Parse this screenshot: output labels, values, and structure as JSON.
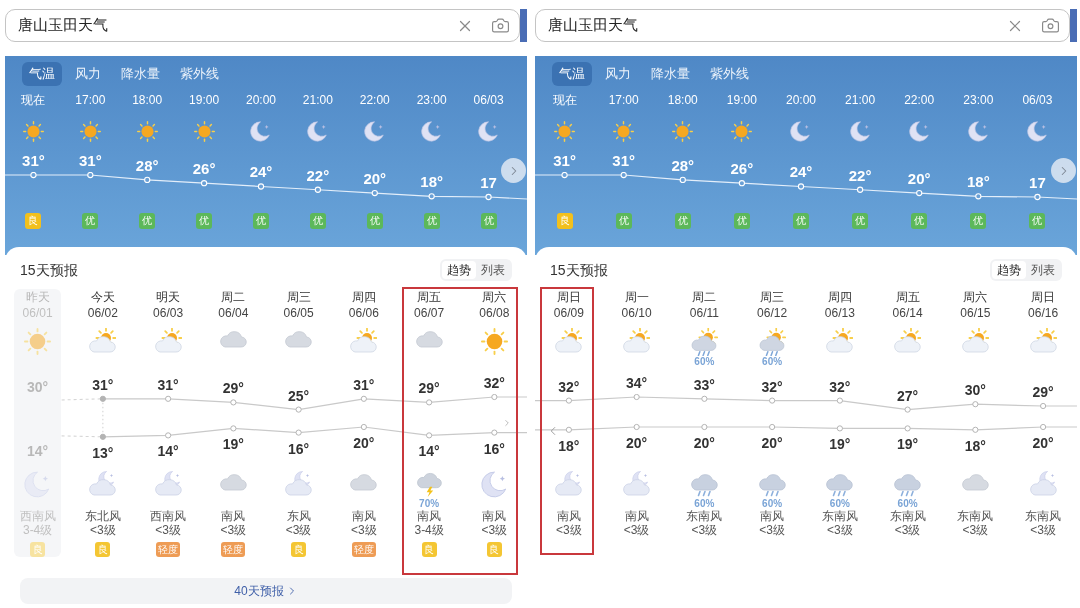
{
  "panels": [
    {
      "search": {
        "value": "唐山玉田天气"
      },
      "hourly": {
        "tabs": [
          {
            "label": "气温",
            "selected": true
          },
          {
            "label": "风力",
            "selected": false
          },
          {
            "label": "降水量",
            "selected": false
          },
          {
            "label": "紫外线",
            "selected": false
          }
        ],
        "has_next": true,
        "hours": [
          {
            "time": "现在",
            "weather": {
              "kind": "sun"
            },
            "temp": "31°",
            "aqi": {
              "label": "良",
              "color": "#f2c01c"
            }
          },
          {
            "time": "17:00",
            "weather": {
              "kind": "sun"
            },
            "temp": "31°",
            "aqi": {
              "label": "优",
              "color": "#5cb85a"
            }
          },
          {
            "time": "18:00",
            "weather": {
              "kind": "sun"
            },
            "temp": "28°",
            "aqi": {
              "label": "优",
              "color": "#5cb85a"
            }
          },
          {
            "time": "19:00",
            "weather": {
              "kind": "sun"
            },
            "temp": "26°",
            "aqi": {
              "label": "优",
              "color": "#5cb85a"
            }
          },
          {
            "time": "20:00",
            "weather": {
              "kind": "moon"
            },
            "temp": "24°",
            "aqi": {
              "label": "优",
              "color": "#5cb85a"
            }
          },
          {
            "time": "21:00",
            "weather": {
              "kind": "moon"
            },
            "temp": "22°",
            "aqi": {
              "label": "优",
              "color": "#5cb85a"
            }
          },
          {
            "time": "22:00",
            "weather": {
              "kind": "moon"
            },
            "temp": "20°",
            "aqi": {
              "label": "优",
              "color": "#5cb85a"
            }
          },
          {
            "time": "23:00",
            "weather": {
              "kind": "moon"
            },
            "temp": "18°",
            "aqi": {
              "label": "优",
              "color": "#5cb85a"
            }
          },
          {
            "time": "06/03",
            "weather": {
              "kind": "moon"
            },
            "temp": "17",
            "aqi": {
              "label": "优",
              "color": "#5cb85a"
            }
          }
        ]
      },
      "forecast": {
        "title": "15天预报",
        "views": [
          {
            "label": "趋势",
            "selected": true
          },
          {
            "label": "列表",
            "selected": false
          }
        ],
        "has_next": true,
        "days": [
          {
            "day": "昨天",
            "date": "06/01",
            "past": true,
            "highlighted": false,
            "day_weather": {
              "kind": "sun"
            },
            "high": "30°",
            "low": "14°",
            "night_weather": {
              "kind": "moon"
            },
            "wind": "西南风",
            "wind_level": "3-4级",
            "aqi": {
              "label": "良",
              "color": "#f7e3a0"
            }
          },
          {
            "day": "今天",
            "date": "06/02",
            "past": false,
            "highlighted": false,
            "day_weather": {
              "kind": "suncloud"
            },
            "high": "31°",
            "low": "13°",
            "night_weather": {
              "kind": "mooncloud"
            },
            "wind": "东北风",
            "wind_level": "<3级",
            "aqi": {
              "label": "良",
              "color": "#f4c633"
            }
          },
          {
            "day": "明天",
            "date": "06/03",
            "past": false,
            "highlighted": false,
            "day_weather": {
              "kind": "suncloud"
            },
            "high": "31°",
            "low": "14°",
            "night_weather": {
              "kind": "mooncloud"
            },
            "wind": "西南风",
            "wind_level": "<3级",
            "aqi": {
              "label": "轻度",
              "color": "#ee9c55"
            }
          },
          {
            "day": "周二",
            "date": "06/04",
            "past": false,
            "highlighted": false,
            "day_weather": {
              "kind": "cloud"
            },
            "high": "29°",
            "low": "19°",
            "night_weather": {
              "kind": "cloud"
            },
            "wind": "南风",
            "wind_level": "<3级",
            "aqi": {
              "label": "轻度",
              "color": "#ee9c55"
            }
          },
          {
            "day": "周三",
            "date": "06/05",
            "past": false,
            "highlighted": false,
            "day_weather": {
              "kind": "cloud"
            },
            "high": "25°",
            "low": "16°",
            "night_weather": {
              "kind": "mooncloud"
            },
            "wind": "东风",
            "wind_level": "<3级",
            "aqi": {
              "label": "良",
              "color": "#f4c633"
            }
          },
          {
            "day": "周四",
            "date": "06/06",
            "past": false,
            "highlighted": false,
            "day_weather": {
              "kind": "suncloud"
            },
            "high": "31°",
            "low": "20°",
            "night_weather": {
              "kind": "cloud"
            },
            "wind": "南风",
            "wind_level": "<3级",
            "aqi": {
              "label": "轻度",
              "color": "#ee9c55"
            }
          },
          {
            "day": "周五",
            "date": "06/07",
            "past": false,
            "highlighted": true,
            "day_weather": {
              "kind": "cloud"
            },
            "high": "29°",
            "low": "14°",
            "night_weather": {
              "kind": "storm",
              "precip": "70%"
            },
            "wind": "南风",
            "wind_level": "3-4级",
            "aqi": {
              "label": "良",
              "color": "#f4c633"
            }
          },
          {
            "day": "周六",
            "date": "06/08",
            "past": false,
            "highlighted": true,
            "day_weather": {
              "kind": "sun"
            },
            "high": "32°",
            "low": "16°",
            "night_weather": {
              "kind": "moon"
            },
            "wind": "南风",
            "wind_level": "<3级",
            "aqi": {
              "label": "良",
              "color": "#f4c633"
            }
          }
        ],
        "more_button": "40天预报"
      }
    },
    {
      "search": {
        "value": "唐山玉田天气"
      },
      "hourly": {
        "tabs": [
          {
            "label": "气温",
            "selected": true
          },
          {
            "label": "风力",
            "selected": false
          },
          {
            "label": "降水量",
            "selected": false
          },
          {
            "label": "紫外线",
            "selected": false
          }
        ],
        "has_next": true,
        "hours": [
          {
            "time": "现在",
            "weather": {
              "kind": "sun"
            },
            "temp": "31°",
            "aqi": {
              "label": "良",
              "color": "#f2c01c"
            }
          },
          {
            "time": "17:00",
            "weather": {
              "kind": "sun"
            },
            "temp": "31°",
            "aqi": {
              "label": "优",
              "color": "#5cb85a"
            }
          },
          {
            "time": "18:00",
            "weather": {
              "kind": "sun"
            },
            "temp": "28°",
            "aqi": {
              "label": "优",
              "color": "#5cb85a"
            }
          },
          {
            "time": "19:00",
            "weather": {
              "kind": "sun"
            },
            "temp": "26°",
            "aqi": {
              "label": "优",
              "color": "#5cb85a"
            }
          },
          {
            "time": "20:00",
            "weather": {
              "kind": "moon"
            },
            "temp": "24°",
            "aqi": {
              "label": "优",
              "color": "#5cb85a"
            }
          },
          {
            "time": "21:00",
            "weather": {
              "kind": "moon"
            },
            "temp": "22°",
            "aqi": {
              "label": "优",
              "color": "#5cb85a"
            }
          },
          {
            "time": "22:00",
            "weather": {
              "kind": "moon"
            },
            "temp": "20°",
            "aqi": {
              "label": "优",
              "color": "#5cb85a"
            }
          },
          {
            "time": "23:00",
            "weather": {
              "kind": "moon"
            },
            "temp": "18°",
            "aqi": {
              "label": "优",
              "color": "#5cb85a"
            }
          },
          {
            "time": "06/03",
            "weather": {
              "kind": "moon"
            },
            "temp": "17",
            "aqi": {
              "label": "优",
              "color": "#5cb85a"
            }
          }
        ]
      },
      "forecast": {
        "title": "15天预报",
        "views": [
          {
            "label": "趋势",
            "selected": true
          },
          {
            "label": "列表",
            "selected": false
          }
        ],
        "has_prev": true,
        "days": [
          {
            "day": "周日",
            "date": "06/09",
            "past": false,
            "highlighted": true,
            "day_weather": {
              "kind": "suncloud"
            },
            "high": "32°",
            "low": "18°",
            "night_weather": {
              "kind": "mooncloud"
            },
            "wind": "南风",
            "wind_level": "<3级"
          },
          {
            "day": "周一",
            "date": "06/10",
            "past": false,
            "highlighted": false,
            "day_weather": {
              "kind": "suncloud"
            },
            "high": "34°",
            "low": "20°",
            "night_weather": {
              "kind": "mooncloud"
            },
            "wind": "南风",
            "wind_level": "<3级"
          },
          {
            "day": "周二",
            "date": "06/11",
            "past": false,
            "highlighted": false,
            "day_weather": {
              "kind": "sunrain",
              "precip": "60%"
            },
            "high": "33°",
            "low": "20°",
            "night_weather": {
              "kind": "rain",
              "precip": "60%"
            },
            "wind": "东南风",
            "wind_level": "<3级"
          },
          {
            "day": "周三",
            "date": "06/12",
            "past": false,
            "highlighted": false,
            "day_weather": {
              "kind": "sunrain",
              "precip": "60%"
            },
            "high": "32°",
            "low": "20°",
            "night_weather": {
              "kind": "rain",
              "precip": "60%"
            },
            "wind": "南风",
            "wind_level": "<3级"
          },
          {
            "day": "周四",
            "date": "06/13",
            "past": false,
            "highlighted": false,
            "day_weather": {
              "kind": "suncloud"
            },
            "high": "32°",
            "low": "19°",
            "night_weather": {
              "kind": "rain",
              "precip": "60%"
            },
            "wind": "东南风",
            "wind_level": "<3级"
          },
          {
            "day": "周五",
            "date": "06/14",
            "past": false,
            "highlighted": false,
            "day_weather": {
              "kind": "suncloud"
            },
            "high": "27°",
            "low": "19°",
            "night_weather": {
              "kind": "rain",
              "precip": "60%"
            },
            "wind": "东南风",
            "wind_level": "<3级"
          },
          {
            "day": "周六",
            "date": "06/15",
            "past": false,
            "highlighted": false,
            "day_weather": {
              "kind": "suncloud"
            },
            "high": "30°",
            "low": "18°",
            "night_weather": {
              "kind": "cloud"
            },
            "wind": "东南风",
            "wind_level": "<3级"
          },
          {
            "day": "周日",
            "date": "06/16",
            "past": false,
            "highlighted": false,
            "day_weather": {
              "kind": "suncloud"
            },
            "high": "29°",
            "low": "20°",
            "night_weather": {
              "kind": "mooncloud"
            },
            "wind": "东南风",
            "wind_level": "<3级"
          }
        ]
      }
    }
  ]
}
